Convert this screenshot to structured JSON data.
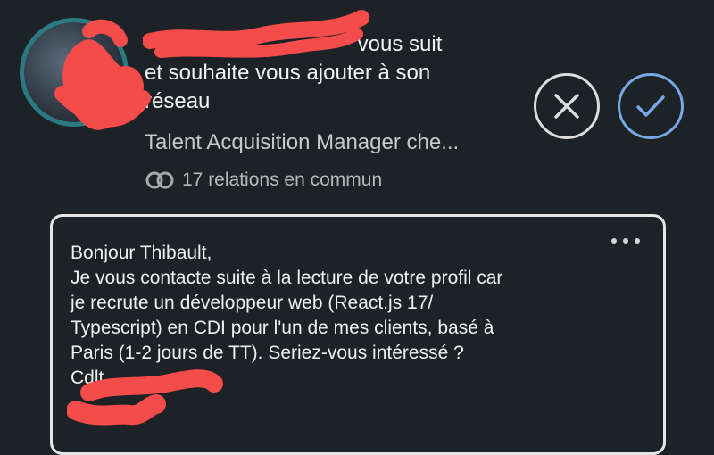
{
  "invitation": {
    "sender_name": "",
    "text_line1": "vous suit",
    "text_line2": "et souhaite vous ajouter à son",
    "text_line3": "réseau",
    "headline": "Talent Acquisition Manager che...",
    "mutual_connections": "17 relations en commun",
    "mutual_icon": "mutual-connections-icon"
  },
  "actions": {
    "ignore_icon": "close-icon",
    "accept_icon": "checkmark-icon",
    "accept_color": "#78a9e6",
    "ignore_color": "#dcdcdc"
  },
  "message": {
    "more_icon": "more-options-icon",
    "lines": [
      "Bonjour Thibault,",
      "Je vous contacte suite à la lecture de votre profil car",
      "je recrute un développeur web  (React.js 17/",
      "Typescript) en CDI pour l'un de mes clients, basé à",
      "Paris (1-2 jours de TT). Seriez-vous intéressé ?",
      "Cdlt",
      ""
    ]
  },
  "colors": {
    "background": "#1d2226",
    "redaction": "#f44b4b"
  }
}
